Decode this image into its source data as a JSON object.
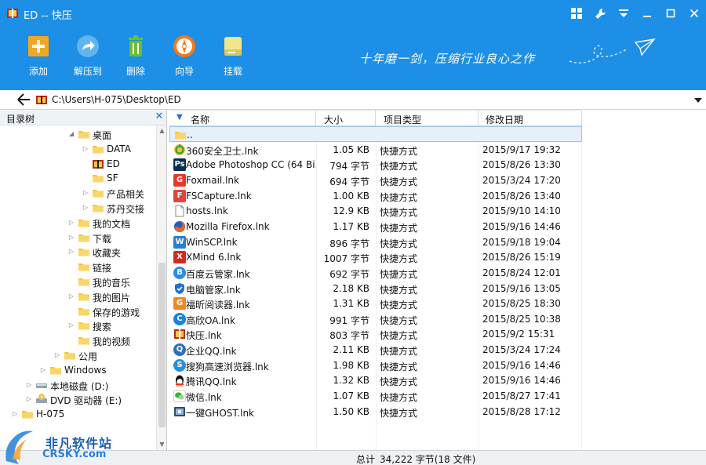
{
  "window": {
    "title": "ED -- 快压"
  },
  "toolbar": [
    {
      "id": "add",
      "label": "添加",
      "icon": "plus-icon",
      "color": "#f5a623"
    },
    {
      "id": "extract",
      "label": "解压到",
      "icon": "share-arrow-icon",
      "color": "#5fb6ef"
    },
    {
      "id": "delete",
      "label": "删除",
      "icon": "trash-icon",
      "color": "#6abf2e"
    },
    {
      "id": "wizard",
      "label": "向导",
      "icon": "compass-icon",
      "color": "#f07a1f"
    },
    {
      "id": "mount",
      "label": "挂载",
      "icon": "drive-icon",
      "color": "#e8dc7a"
    }
  ],
  "slogan": "十年磨一剑，压缩行业良心之作",
  "address": {
    "path": "C:\\Users\\H-075\\Desktop\\ED"
  },
  "tree": {
    "title": "目录树",
    "items": [
      {
        "label": "桌面",
        "level": 5,
        "arrow": "expanded"
      },
      {
        "label": "DATA",
        "level": 6,
        "arrow": "collapsed"
      },
      {
        "label": "ED",
        "level": 6,
        "arrow": "none",
        "special": true
      },
      {
        "label": "SF",
        "level": 6,
        "arrow": "none"
      },
      {
        "label": "产品相关",
        "level": 6,
        "arrow": "collapsed"
      },
      {
        "label": "苏丹交接",
        "level": 6,
        "arrow": "collapsed"
      },
      {
        "label": "我的文档",
        "level": 5,
        "arrow": "collapsed"
      },
      {
        "label": "下载",
        "level": 5,
        "arrow": "collapsed"
      },
      {
        "label": "收藏夹",
        "level": 5,
        "arrow": "collapsed"
      },
      {
        "label": "链接",
        "level": 5,
        "arrow": "none"
      },
      {
        "label": "我的音乐",
        "level": 5,
        "arrow": "none"
      },
      {
        "label": "我的图片",
        "level": 5,
        "arrow": "collapsed"
      },
      {
        "label": "保存的游戏",
        "level": 5,
        "arrow": "none"
      },
      {
        "label": "搜索",
        "level": 5,
        "arrow": "collapsed"
      },
      {
        "label": "我的视频",
        "level": 5,
        "arrow": "none"
      },
      {
        "label": "公用",
        "level": 4,
        "arrow": "collapsed"
      },
      {
        "label": "Windows",
        "level": 3,
        "arrow": "collapsed"
      },
      {
        "label": "本地磁盘 (D:)",
        "level": 2,
        "arrow": "collapsed",
        "drive": true
      },
      {
        "label": "DVD 驱动器 (E:)",
        "level": 2,
        "arrow": "collapsed",
        "dvd": true
      },
      {
        "label": "H-075",
        "level": 1,
        "arrow": "collapsed"
      }
    ]
  },
  "columns": {
    "name": "名称",
    "size": "大小",
    "type": "项目类型",
    "date": "修改日期"
  },
  "files": [
    {
      "name": "..",
      "size": "",
      "type": "",
      "date": "",
      "icon": "folder",
      "parent": true
    },
    {
      "name": "360安全卫士.lnk",
      "size": "1.05 KB",
      "type": "快捷方式",
      "date": "2015/9/17 19:32",
      "icon": "360",
      "color": "#3aa13a"
    },
    {
      "name": "Adobe Photoshop CC (64 Bi...",
      "size": "794 字节",
      "type": "快捷方式",
      "date": "2015/8/26 13:30",
      "icon": "Ps",
      "color": "#0b2d4f"
    },
    {
      "name": "Foxmail.lnk",
      "size": "694 字节",
      "type": "快捷方式",
      "date": "2015/3/24 17:20",
      "icon": "G",
      "color": "#e4392b"
    },
    {
      "name": "FSCapture.lnk",
      "size": "1.00 KB",
      "type": "快捷方式",
      "date": "2015/8/26 13:40",
      "icon": "F",
      "color": "#e0453a"
    },
    {
      "name": "hosts.lnk",
      "size": "12.9 KB",
      "type": "快捷方式",
      "date": "2015/9/10 14:10",
      "icon": "doc",
      "color": "#ffffff"
    },
    {
      "name": "Mozilla Firefox.lnk",
      "size": "1.17 KB",
      "type": "快捷方式",
      "date": "2015/9/16 14:46",
      "icon": "ff",
      "color": "#e8661e"
    },
    {
      "name": "WinSCP.lnk",
      "size": "896 字节",
      "type": "快捷方式",
      "date": "2015/9/18 19:04",
      "icon": "W",
      "color": "#2a7fd0"
    },
    {
      "name": "XMind 6.lnk",
      "size": "1007 字节",
      "type": "快捷方式",
      "date": "2015/8/26 15:19",
      "icon": "X",
      "color": "#d42a1e"
    },
    {
      "name": "百度云管家.lnk",
      "size": "692 字节",
      "type": "快捷方式",
      "date": "2015/8/24 12:01",
      "icon": "B",
      "color": "#2d8be0"
    },
    {
      "name": "电脑管家.lnk",
      "size": "2.18 KB",
      "type": "快捷方式",
      "date": "2015/9/16 13:05",
      "icon": "shield",
      "color": "#1f6fd6"
    },
    {
      "name": "福昕阅读器.lnk",
      "size": "1.31 KB",
      "type": "快捷方式",
      "date": "2015/8/25 18:30",
      "icon": "G",
      "color": "#f08a1d"
    },
    {
      "name": "高欣OA.lnk",
      "size": "991 字节",
      "type": "快捷方式",
      "date": "2015/8/25 10:38",
      "icon": "C",
      "color": "#1d82d6"
    },
    {
      "name": "快压.lnk",
      "size": "803 字节",
      "type": "快捷方式",
      "date": "2015/9/2 15:31",
      "icon": "kz",
      "color": "#8b3a0d"
    },
    {
      "name": "企业QQ.lnk",
      "size": "2.11 KB",
      "type": "快捷方式",
      "date": "2015/3/24 17:24",
      "icon": "Q",
      "color": "#2a6fc2"
    },
    {
      "name": "搜狗高速浏览器.lnk",
      "size": "1.98 KB",
      "type": "快捷方式",
      "date": "2015/9/16 14:46",
      "icon": "S",
      "color": "#2a8ee0"
    },
    {
      "name": "腾讯QQ.lnk",
      "size": "1.32 KB",
      "type": "快捷方式",
      "date": "2015/9/16 14:46",
      "icon": "qq",
      "color": "#111111"
    },
    {
      "name": "微信.lnk",
      "size": "1.07 KB",
      "type": "快捷方式",
      "date": "2015/8/27 17:41",
      "icon": "wx",
      "color": "#35b534"
    },
    {
      "name": "一键GHOST.lnk",
      "size": "1.50 KB",
      "type": "快捷方式",
      "date": "2015/8/28 17:12",
      "icon": "gh",
      "color": "#5a6f8a"
    }
  ],
  "status": {
    "label": "总计",
    "value": "34,222 字节(18 文件)"
  },
  "watermark": {
    "line1": "非凡软件站",
    "line2": "CRSKY.com"
  },
  "colors": {
    "header": "#1d8fe6",
    "folder": "#f4c542",
    "selection": "#e6f0fb"
  }
}
